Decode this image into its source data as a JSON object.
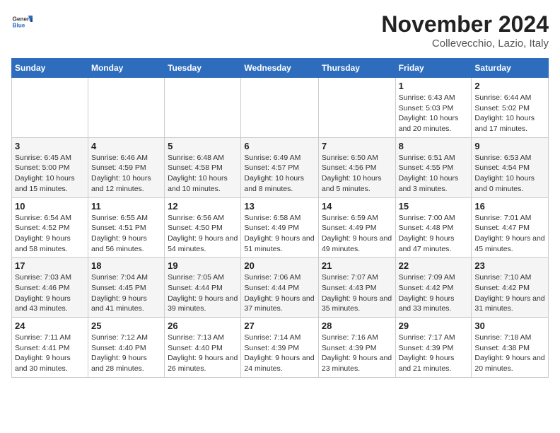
{
  "header": {
    "logo_general": "General",
    "logo_blue": "Blue",
    "month": "November 2024",
    "location": "Collevecchio, Lazio, Italy"
  },
  "weekdays": [
    "Sunday",
    "Monday",
    "Tuesday",
    "Wednesday",
    "Thursday",
    "Friday",
    "Saturday"
  ],
  "weeks": [
    [
      {
        "day": "",
        "info": ""
      },
      {
        "day": "",
        "info": ""
      },
      {
        "day": "",
        "info": ""
      },
      {
        "day": "",
        "info": ""
      },
      {
        "day": "",
        "info": ""
      },
      {
        "day": "1",
        "info": "Sunrise: 6:43 AM\nSunset: 5:03 PM\nDaylight: 10 hours and 20 minutes."
      },
      {
        "day": "2",
        "info": "Sunrise: 6:44 AM\nSunset: 5:02 PM\nDaylight: 10 hours and 17 minutes."
      }
    ],
    [
      {
        "day": "3",
        "info": "Sunrise: 6:45 AM\nSunset: 5:00 PM\nDaylight: 10 hours and 15 minutes."
      },
      {
        "day": "4",
        "info": "Sunrise: 6:46 AM\nSunset: 4:59 PM\nDaylight: 10 hours and 12 minutes."
      },
      {
        "day": "5",
        "info": "Sunrise: 6:48 AM\nSunset: 4:58 PM\nDaylight: 10 hours and 10 minutes."
      },
      {
        "day": "6",
        "info": "Sunrise: 6:49 AM\nSunset: 4:57 PM\nDaylight: 10 hours and 8 minutes."
      },
      {
        "day": "7",
        "info": "Sunrise: 6:50 AM\nSunset: 4:56 PM\nDaylight: 10 hours and 5 minutes."
      },
      {
        "day": "8",
        "info": "Sunrise: 6:51 AM\nSunset: 4:55 PM\nDaylight: 10 hours and 3 minutes."
      },
      {
        "day": "9",
        "info": "Sunrise: 6:53 AM\nSunset: 4:54 PM\nDaylight: 10 hours and 0 minutes."
      }
    ],
    [
      {
        "day": "10",
        "info": "Sunrise: 6:54 AM\nSunset: 4:52 PM\nDaylight: 9 hours and 58 minutes."
      },
      {
        "day": "11",
        "info": "Sunrise: 6:55 AM\nSunset: 4:51 PM\nDaylight: 9 hours and 56 minutes."
      },
      {
        "day": "12",
        "info": "Sunrise: 6:56 AM\nSunset: 4:50 PM\nDaylight: 9 hours and 54 minutes."
      },
      {
        "day": "13",
        "info": "Sunrise: 6:58 AM\nSunset: 4:49 PM\nDaylight: 9 hours and 51 minutes."
      },
      {
        "day": "14",
        "info": "Sunrise: 6:59 AM\nSunset: 4:49 PM\nDaylight: 9 hours and 49 minutes."
      },
      {
        "day": "15",
        "info": "Sunrise: 7:00 AM\nSunset: 4:48 PM\nDaylight: 9 hours and 47 minutes."
      },
      {
        "day": "16",
        "info": "Sunrise: 7:01 AM\nSunset: 4:47 PM\nDaylight: 9 hours and 45 minutes."
      }
    ],
    [
      {
        "day": "17",
        "info": "Sunrise: 7:03 AM\nSunset: 4:46 PM\nDaylight: 9 hours and 43 minutes."
      },
      {
        "day": "18",
        "info": "Sunrise: 7:04 AM\nSunset: 4:45 PM\nDaylight: 9 hours and 41 minutes."
      },
      {
        "day": "19",
        "info": "Sunrise: 7:05 AM\nSunset: 4:44 PM\nDaylight: 9 hours and 39 minutes."
      },
      {
        "day": "20",
        "info": "Sunrise: 7:06 AM\nSunset: 4:44 PM\nDaylight: 9 hours and 37 minutes."
      },
      {
        "day": "21",
        "info": "Sunrise: 7:07 AM\nSunset: 4:43 PM\nDaylight: 9 hours and 35 minutes."
      },
      {
        "day": "22",
        "info": "Sunrise: 7:09 AM\nSunset: 4:42 PM\nDaylight: 9 hours and 33 minutes."
      },
      {
        "day": "23",
        "info": "Sunrise: 7:10 AM\nSunset: 4:42 PM\nDaylight: 9 hours and 31 minutes."
      }
    ],
    [
      {
        "day": "24",
        "info": "Sunrise: 7:11 AM\nSunset: 4:41 PM\nDaylight: 9 hours and 30 minutes."
      },
      {
        "day": "25",
        "info": "Sunrise: 7:12 AM\nSunset: 4:40 PM\nDaylight: 9 hours and 28 minutes."
      },
      {
        "day": "26",
        "info": "Sunrise: 7:13 AM\nSunset: 4:40 PM\nDaylight: 9 hours and 26 minutes."
      },
      {
        "day": "27",
        "info": "Sunrise: 7:14 AM\nSunset: 4:39 PM\nDaylight: 9 hours and 24 minutes."
      },
      {
        "day": "28",
        "info": "Sunrise: 7:16 AM\nSunset: 4:39 PM\nDaylight: 9 hours and 23 minutes."
      },
      {
        "day": "29",
        "info": "Sunrise: 7:17 AM\nSunset: 4:39 PM\nDaylight: 9 hours and 21 minutes."
      },
      {
        "day": "30",
        "info": "Sunrise: 7:18 AM\nSunset: 4:38 PM\nDaylight: 9 hours and 20 minutes."
      }
    ]
  ]
}
